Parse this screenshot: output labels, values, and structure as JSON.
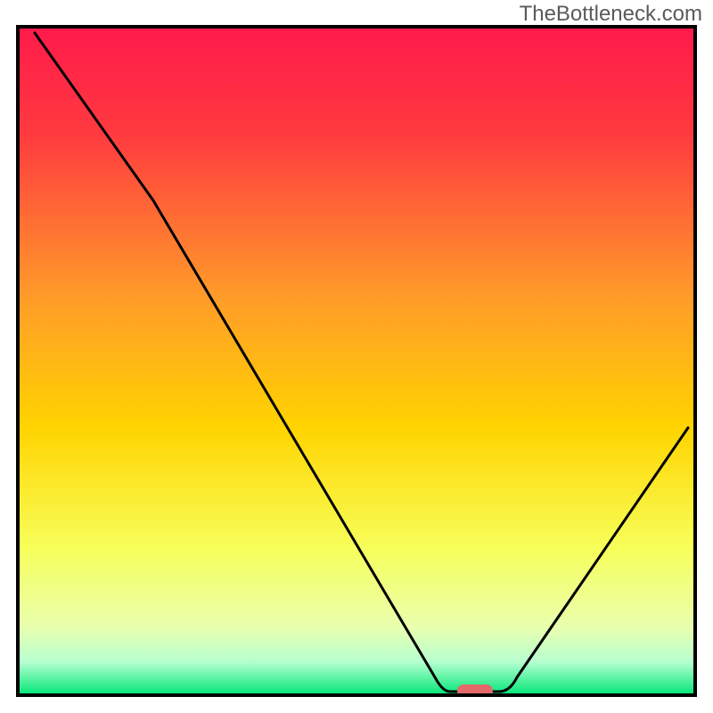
{
  "watermark": "TheBottleneck.com",
  "chart_data": {
    "type": "line",
    "title": "",
    "xlabel": "",
    "ylabel": "",
    "xlim": [
      0,
      100
    ],
    "ylim": [
      0,
      100
    ],
    "axes_hidden": true,
    "grid": false,
    "background_gradient": {
      "top": "#ff1a4b",
      "mid_upper": "#ff7a2a",
      "mid": "#ffd400",
      "mid_lower": "#f8ff66",
      "bottom": "#00e676"
    },
    "curve": [
      {
        "x": 2.5,
        "y": 99
      },
      {
        "x": 20,
        "y": 74
      },
      {
        "x": 62,
        "y": 2
      },
      {
        "x": 63,
        "y": 0.5
      },
      {
        "x": 71,
        "y": 0.5
      },
      {
        "x": 73,
        "y": 2
      },
      {
        "x": 99,
        "y": 40
      }
    ],
    "marker": {
      "x": 67,
      "y": 0.8,
      "color": "#e46a6a"
    }
  }
}
